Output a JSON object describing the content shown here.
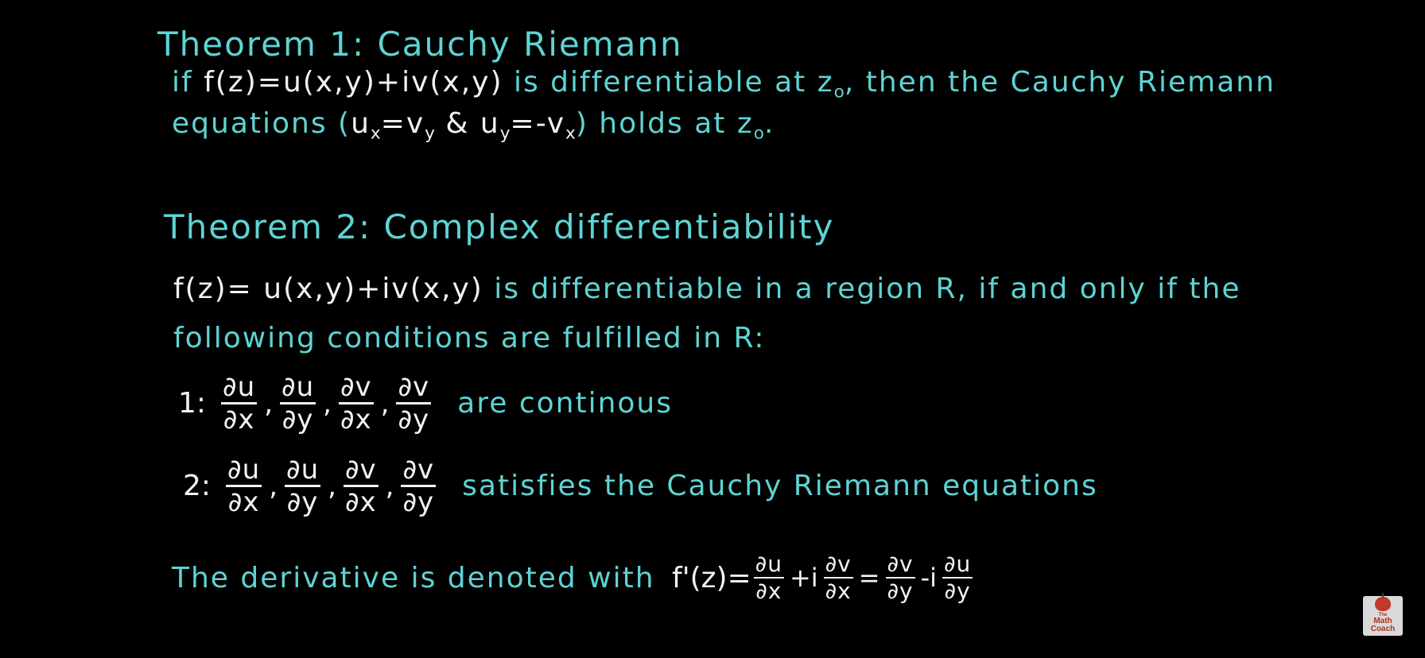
{
  "theorem1": {
    "title": "Theorem 1: Cauchy Riemann",
    "line1_a": "if ",
    "line1_formula": "f(z)=u(x,y)+iv(x,y)",
    "line1_b": " is differentiable at z",
    "line1_sub0": "o",
    "line1_c": ", then the Cauchy Riemann",
    "line2_a": "equations (",
    "line2_formula_u": "u",
    "line2_formula_x": "x",
    "line2_formula_eq": "=v",
    "line2_formula_y": "y",
    "line2_formula_amp": " & ",
    "line2_formula_u2": "u",
    "line2_formula_y2": "y",
    "line2_formula_eq2": "=-v",
    "line2_formula_x2": "x",
    "line2_b": ") holds at z",
    "line2_sub0": "o",
    "line2_c": "."
  },
  "theorem2": {
    "title": "Theorem 2: Complex differentiability",
    "line1_formula": "f(z)= u(x,y)+iv(x,y)",
    "line1_text": " is differentiable in a region R, if and only if the",
    "line2_text": "following conditions are fulfilled in R:",
    "cond1_label": "1:",
    "cond1_text": "are continous",
    "cond2_label": "2:",
    "cond2_text": "satisfies the Cauchy Riemann equations",
    "partials": [
      {
        "num": "∂u",
        "den": "∂x"
      },
      {
        "num": "∂u",
        "den": "∂y"
      },
      {
        "num": "∂v",
        "den": "∂x"
      },
      {
        "num": "∂v",
        "den": "∂y"
      }
    ],
    "derivative_text": "The derivative is denoted with ",
    "derivative_lhs": "f'(z)=",
    "derivative_plus_i": "+i",
    "derivative_eq": "=",
    "derivative_minus_i": "-i",
    "d1": {
      "num": "∂u",
      "den": "∂x"
    },
    "d2": {
      "num": "∂v",
      "den": "∂x"
    },
    "d3": {
      "num": "∂v",
      "den": "∂y"
    },
    "d4": {
      "num": "∂u",
      "den": "∂y"
    }
  },
  "logo": {
    "text_line1": "The",
    "text_line2": "Math",
    "text_line3": "Coach"
  }
}
